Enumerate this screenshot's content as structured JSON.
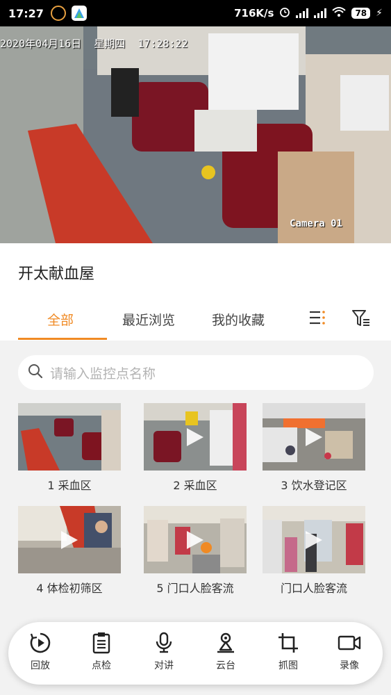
{
  "status_bar": {
    "time": "17:27",
    "net_speed": "716K/s",
    "battery": "78"
  },
  "video": {
    "osd_datetime": "2020年04月16日  星期四  17:28:22",
    "camera_label": "Camera 01"
  },
  "place_title": "开太献血屋",
  "tabs": [
    {
      "label": "全部",
      "active": true
    },
    {
      "label": "最近浏览",
      "active": false
    },
    {
      "label": "我的收藏",
      "active": false
    }
  ],
  "search": {
    "placeholder": "请输入监控点名称"
  },
  "cameras": [
    {
      "label": "1 采血区",
      "selected": true
    },
    {
      "label": "2 采血区",
      "selected": false
    },
    {
      "label": "3 饮水登记区",
      "selected": false
    },
    {
      "label": "4 体检初筛区",
      "selected": false
    },
    {
      "label": "5 门口人脸客流",
      "selected": false
    },
    {
      "label": "门口人脸客流",
      "selected": false
    }
  ],
  "toolbar": {
    "playback": "回放",
    "inspect": "点检",
    "talk": "对讲",
    "ptz": "云台",
    "capture": "抓图",
    "record": "录像"
  },
  "colors": {
    "accent": "#f08a24"
  }
}
